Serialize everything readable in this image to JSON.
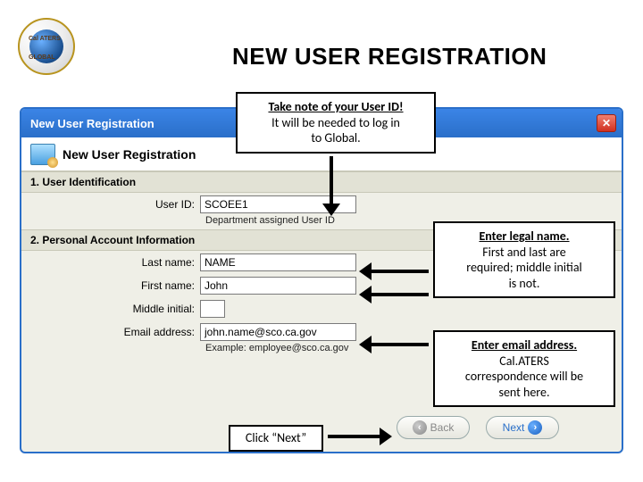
{
  "slide": {
    "title": "NEW USER REGISTRATION",
    "logo_top": "Cal ATERS",
    "logo_bottom": "GLOBAL"
  },
  "dialog": {
    "titlebar": "New User Registration",
    "close_label": "✕",
    "subheader": "New User Registration",
    "sections": {
      "identification": {
        "header": "1. User Identification",
        "user_id_label": "User ID:",
        "user_id_value": "SCOEE1",
        "user_id_helper": "Department assigned User ID"
      },
      "personal": {
        "header": "2. Personal Account Information",
        "last_name_label": "Last name:",
        "last_name_value": "NAME",
        "first_name_label": "First name:",
        "first_name_value": "John",
        "middle_initial_label": "Middle initial:",
        "middle_initial_value": "",
        "email_label": "Email address:",
        "email_value": "john.name@sco.ca.gov",
        "email_helper": "Example: employee@sco.ca.gov"
      }
    },
    "nav": {
      "back_label": "Back",
      "next_label": "Next"
    }
  },
  "callouts": {
    "userid_line1": "Take note of your User ID!",
    "userid_line2": "It will be needed to log in",
    "userid_line3": "to Global.",
    "legal_line1": "Enter legal name.",
    "legal_line2": "First and last are",
    "legal_line3": "required; middle initial",
    "legal_line4": "is not.",
    "email_line1": "Enter email address.",
    "email_line2": "Cal.ATERS",
    "email_line3": "correspondence will be",
    "email_line4": "sent here.",
    "next": "Click “Next”"
  }
}
